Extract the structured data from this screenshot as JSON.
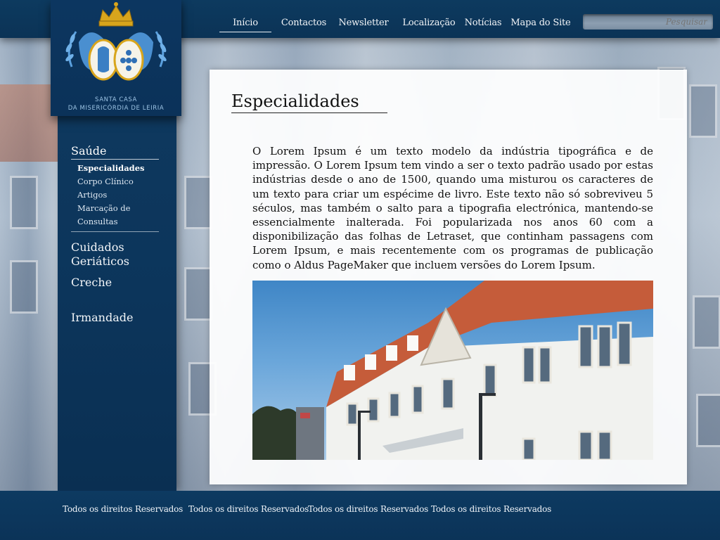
{
  "site": {
    "logo_line1": "SANTA CASA",
    "logo_line2": "DA MISERICÓRDIA DE LEIRIA"
  },
  "nav": {
    "items": [
      {
        "label": "Início",
        "active": true
      },
      {
        "label": "Contactos"
      },
      {
        "label": "Newsletter"
      },
      {
        "label": "Localização"
      },
      {
        "label": "Notícias"
      },
      {
        "label": "Mapa do Site"
      }
    ],
    "search_placeholder": "Pesquisar"
  },
  "sidebar": {
    "section_title": "Saúde",
    "subitems": [
      {
        "label": "Especialidades",
        "active": true
      },
      {
        "label": "Corpo Clínico"
      },
      {
        "label": "Artigos"
      },
      {
        "label": "Marcação de Consultas"
      }
    ],
    "items": [
      {
        "label": "Cuidados Geriáticos"
      },
      {
        "label": "Creche"
      },
      {
        "label": "Irmandade"
      }
    ]
  },
  "main": {
    "title": "Especialidades",
    "body": "O Lorem Ipsum é um texto modelo da indústria tipográfica e de impressão. O Lorem Ipsum tem vindo a ser o texto padrão usado por estas indústrias desde o ano de 1500, quando uma misturou os caracteres de um texto para criar um espécime de livro. Este texto não só sobreviveu 5 séculos, mas também o salto para a tipografia electrónica, mantendo-se essencialmente inalterada. Foi popularizada nos anos 60 com a disponibilização das folhas de Letraset, que continham passagens com Lorem Ipsum, e mais recentemente com os programas de publicação como o Aldus PageMaker que incluem versões do Lorem Ipsum."
  },
  "footer": {
    "items": [
      "Todos os direitos Reservados",
      "Todos os direitos Reservados",
      "Todos os direitos Reservados",
      "Todos os direitos Reservados"
    ]
  },
  "colors": {
    "brand_navy": "#0c365c",
    "logo_blue": "#4a8fd0",
    "logo_gold": "#d8a51c"
  }
}
